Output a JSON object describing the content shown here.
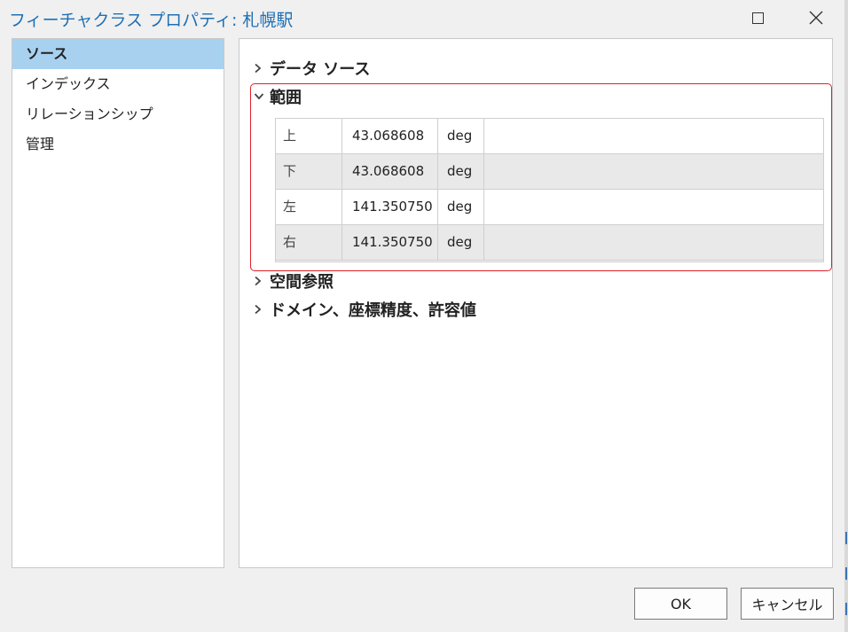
{
  "window": {
    "title": "フィーチャクラス プロパティ: 札幌駅"
  },
  "sidebar": {
    "items": [
      {
        "label": "ソース",
        "selected": true
      },
      {
        "label": "インデックス",
        "selected": false
      },
      {
        "label": "リレーションシップ",
        "selected": false
      },
      {
        "label": "管理",
        "selected": false
      }
    ]
  },
  "sections": {
    "data_source": {
      "label": "データ ソース",
      "expanded": false
    },
    "extent": {
      "label": "範囲",
      "expanded": true
    },
    "spatial_reference": {
      "label": "空間参照",
      "expanded": false
    },
    "domain": {
      "label": "ドメイン、座標精度、許容値",
      "expanded": false
    }
  },
  "extent_table": {
    "rows": [
      {
        "label": "上",
        "value": "43.068608",
        "unit": "deg"
      },
      {
        "label": "下",
        "value": "43.068608",
        "unit": "deg"
      },
      {
        "label": "左",
        "value": "141.350750",
        "unit": "deg"
      },
      {
        "label": "右",
        "value": "141.350750",
        "unit": "deg"
      }
    ]
  },
  "buttons": {
    "ok": "OK",
    "cancel": "キャンセル"
  },
  "colors": {
    "title": "#1f6fb5",
    "selected_nav": "#a8d1f0",
    "highlight_border": "#e0202a"
  }
}
